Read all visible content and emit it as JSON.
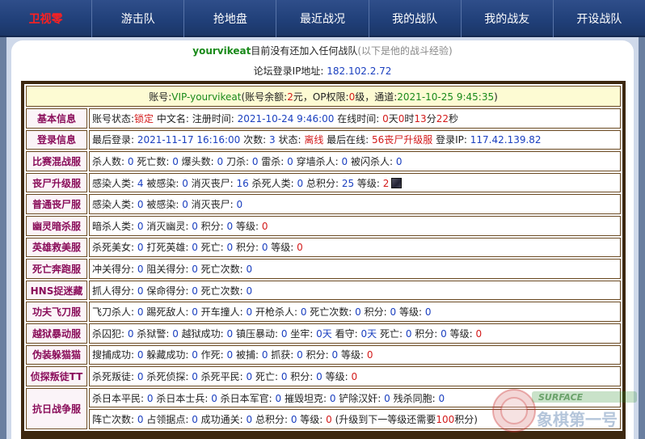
{
  "nav": {
    "items": [
      "卫视零",
      "游击队",
      "抢地盘",
      "最近战况",
      "我的战队",
      "我的战友",
      "开设战队"
    ]
  },
  "header": {
    "username": "yourvikeat",
    "status_text": "目前没有还加入任何战队",
    "hint": "(以下是他的战斗经验)"
  },
  "ip": {
    "label": "论坛登录IP地址:",
    "value": "182.102.2.72"
  },
  "account": {
    "p1": "账号:",
    "name": "VIP-yourvikeat",
    "p2": "(账号余额:",
    "balance": "2",
    "p3": "元，OP权限:",
    "op": "0",
    "p4": "级，通道:",
    "channel_time": "2021-10-25 9:45:35",
    "p5": ")"
  },
  "rows": [
    {
      "label": "基本信息",
      "segs": [
        {
          "t": "账号状态:",
          "c": "k"
        },
        {
          "t": "锁定",
          "c": "r"
        },
        {
          "t": " 中文名:  注册时间: ",
          "c": "k"
        },
        {
          "t": "2021-10-24 9:46:00",
          "c": "b"
        },
        {
          "t": " 在线时间: ",
          "c": "k"
        },
        {
          "t": "0",
          "c": "r"
        },
        {
          "t": "天",
          "c": "k"
        },
        {
          "t": "0",
          "c": "r"
        },
        {
          "t": "时",
          "c": "k"
        },
        {
          "t": "13",
          "c": "r"
        },
        {
          "t": "分",
          "c": "k"
        },
        {
          "t": "22",
          "c": "r"
        },
        {
          "t": "秒",
          "c": "k"
        }
      ]
    },
    {
      "label": "登录信息",
      "segs": [
        {
          "t": "最后登录: ",
          "c": "k"
        },
        {
          "t": "2021-11-17 16:16:00",
          "c": "b"
        },
        {
          "t": " 次数: ",
          "c": "k"
        },
        {
          "t": "3",
          "c": "b"
        },
        {
          "t": " 状态: ",
          "c": "k"
        },
        {
          "t": "离线",
          "c": "r"
        },
        {
          "t": " 最后在线: ",
          "c": "k"
        },
        {
          "t": "56丧尸升级服",
          "c": "r"
        },
        {
          "t": " 登录IP: ",
          "c": "k"
        },
        {
          "t": "117.42.139.82",
          "c": "b"
        }
      ]
    },
    {
      "label": "比赛混战服",
      "segs": [
        {
          "t": "杀人数: ",
          "c": "k"
        },
        {
          "t": "0",
          "c": "b"
        },
        {
          "t": " 死亡数: ",
          "c": "k"
        },
        {
          "t": "0",
          "c": "b"
        },
        {
          "t": " 爆头数: ",
          "c": "k"
        },
        {
          "t": "0",
          "c": "b"
        },
        {
          "t": " 刀杀: ",
          "c": "k"
        },
        {
          "t": "0",
          "c": "b"
        },
        {
          "t": " 雷杀: ",
          "c": "k"
        },
        {
          "t": "0",
          "c": "b"
        },
        {
          "t": " 穿墙杀人: ",
          "c": "k"
        },
        {
          "t": "0",
          "c": "b"
        },
        {
          "t": " 被闪杀人: ",
          "c": "k"
        },
        {
          "t": "0",
          "c": "b"
        }
      ]
    },
    {
      "label": "丧尸升级服",
      "avatar": true,
      "segs": [
        {
          "t": "感染人类: ",
          "c": "k"
        },
        {
          "t": "4",
          "c": "b"
        },
        {
          "t": " 被感染: ",
          "c": "k"
        },
        {
          "t": "0",
          "c": "b"
        },
        {
          "t": " 消灭丧尸: ",
          "c": "k"
        },
        {
          "t": "16",
          "c": "b"
        },
        {
          "t": " 杀死人类: ",
          "c": "k"
        },
        {
          "t": "0",
          "c": "b"
        },
        {
          "t": " 总积分: ",
          "c": "k"
        },
        {
          "t": "25",
          "c": "b"
        },
        {
          "t": " 等级: ",
          "c": "k"
        },
        {
          "t": "2",
          "c": "r"
        }
      ]
    },
    {
      "label": "普通丧尸服",
      "segs": [
        {
          "t": "感染人类: ",
          "c": "k"
        },
        {
          "t": "0",
          "c": "b"
        },
        {
          "t": " 被感染: ",
          "c": "k"
        },
        {
          "t": "0",
          "c": "b"
        },
        {
          "t": " 消灭丧尸: ",
          "c": "k"
        },
        {
          "t": "0",
          "c": "b"
        }
      ]
    },
    {
      "label": "幽灵暗杀服",
      "segs": [
        {
          "t": "暗杀人类: ",
          "c": "k"
        },
        {
          "t": "0",
          "c": "b"
        },
        {
          "t": " 消灭幽灵: ",
          "c": "k"
        },
        {
          "t": "0",
          "c": "b"
        },
        {
          "t": " 积分: ",
          "c": "k"
        },
        {
          "t": "0",
          "c": "b"
        },
        {
          "t": " 等级: ",
          "c": "k"
        },
        {
          "t": "0",
          "c": "r"
        }
      ]
    },
    {
      "label": "英雄救美服",
      "segs": [
        {
          "t": "杀死美女: ",
          "c": "k"
        },
        {
          "t": "0",
          "c": "b"
        },
        {
          "t": " 打死英雄: ",
          "c": "k"
        },
        {
          "t": "0",
          "c": "b"
        },
        {
          "t": " 死亡: ",
          "c": "k"
        },
        {
          "t": "0",
          "c": "b"
        },
        {
          "t": " 积分: ",
          "c": "k"
        },
        {
          "t": "0",
          "c": "b"
        },
        {
          "t": " 等级: ",
          "c": "k"
        },
        {
          "t": "0",
          "c": "r"
        }
      ]
    },
    {
      "label": "死亡奔跑服",
      "segs": [
        {
          "t": "冲关得分: ",
          "c": "k"
        },
        {
          "t": "0",
          "c": "b"
        },
        {
          "t": " 阻关得分: ",
          "c": "k"
        },
        {
          "t": "0",
          "c": "b"
        },
        {
          "t": " 死亡次数: ",
          "c": "k"
        },
        {
          "t": "0",
          "c": "b"
        }
      ]
    },
    {
      "label": "HNS捉迷藏",
      "segs": [
        {
          "t": "抓人得分: ",
          "c": "k"
        },
        {
          "t": "0",
          "c": "b"
        },
        {
          "t": " 保命得分: ",
          "c": "k"
        },
        {
          "t": "0",
          "c": "b"
        },
        {
          "t": " 死亡次数: ",
          "c": "k"
        },
        {
          "t": "0",
          "c": "b"
        }
      ]
    },
    {
      "label": "功夫飞刀服",
      "segs": [
        {
          "t": "飞刀杀人: ",
          "c": "k"
        },
        {
          "t": "0",
          "c": "b"
        },
        {
          "t": " 踢死敌人: ",
          "c": "k"
        },
        {
          "t": "0",
          "c": "b"
        },
        {
          "t": " 开车撞人: ",
          "c": "k"
        },
        {
          "t": "0",
          "c": "b"
        },
        {
          "t": " 开枪杀人: ",
          "c": "k"
        },
        {
          "t": "0",
          "c": "b"
        },
        {
          "t": " 死亡次数: ",
          "c": "k"
        },
        {
          "t": "0",
          "c": "b"
        },
        {
          "t": " 积分: ",
          "c": "k"
        },
        {
          "t": "0",
          "c": "b"
        },
        {
          "t": " 等级: ",
          "c": "k"
        },
        {
          "t": "0",
          "c": "b"
        }
      ]
    },
    {
      "label": "越狱暴动服",
      "segs": [
        {
          "t": "杀囚犯: ",
          "c": "k"
        },
        {
          "t": "0",
          "c": "b"
        },
        {
          "t": " 杀狱警: ",
          "c": "k"
        },
        {
          "t": "0",
          "c": "b"
        },
        {
          "t": " 越狱成功: ",
          "c": "k"
        },
        {
          "t": "0",
          "c": "b"
        },
        {
          "t": " 镇压暴动: ",
          "c": "k"
        },
        {
          "t": "0",
          "c": "b"
        },
        {
          "t": " 坐牢: ",
          "c": "k"
        },
        {
          "t": "0天",
          "c": "b"
        },
        {
          "t": " 看守: ",
          "c": "k"
        },
        {
          "t": "0天",
          "c": "b"
        },
        {
          "t": " 死亡: ",
          "c": "k"
        },
        {
          "t": "0",
          "c": "b"
        },
        {
          "t": " 积分: ",
          "c": "k"
        },
        {
          "t": "0",
          "c": "b"
        },
        {
          "t": " 等级: ",
          "c": "k"
        },
        {
          "t": "0",
          "c": "r"
        }
      ]
    },
    {
      "label": "伪装躲猫猫",
      "segs": [
        {
          "t": "搜捕成功: ",
          "c": "k"
        },
        {
          "t": "0",
          "c": "b"
        },
        {
          "t": " 躲藏成功: ",
          "c": "k"
        },
        {
          "t": "0",
          "c": "b"
        },
        {
          "t": " 作死: ",
          "c": "k"
        },
        {
          "t": "0",
          "c": "b"
        },
        {
          "t": " 被捕: ",
          "c": "k"
        },
        {
          "t": "0",
          "c": "b"
        },
        {
          "t": " 抓获: ",
          "c": "k"
        },
        {
          "t": "0",
          "c": "b"
        },
        {
          "t": " 积分: ",
          "c": "k"
        },
        {
          "t": "0",
          "c": "b"
        },
        {
          "t": " 等级: ",
          "c": "k"
        },
        {
          "t": "0",
          "c": "r"
        }
      ]
    },
    {
      "label": "侦探叛徒TT",
      "segs": [
        {
          "t": "杀死叛徒: ",
          "c": "k"
        },
        {
          "t": "0",
          "c": "b"
        },
        {
          "t": " 杀死侦探: ",
          "c": "k"
        },
        {
          "t": "0",
          "c": "b"
        },
        {
          "t": " 杀死平民: ",
          "c": "k"
        },
        {
          "t": "0",
          "c": "b"
        },
        {
          "t": " 死亡: ",
          "c": "k"
        },
        {
          "t": "0",
          "c": "b"
        },
        {
          "t": " 积分: ",
          "c": "k"
        },
        {
          "t": "0",
          "c": "b"
        },
        {
          "t": " 等级: ",
          "c": "k"
        },
        {
          "t": "0",
          "c": "r"
        }
      ]
    }
  ],
  "anti": {
    "label": "抗日战争服",
    "line1": [
      {
        "t": "杀日本平民: ",
        "c": "k"
      },
      {
        "t": "0",
        "c": "b"
      },
      {
        "t": " 杀日本士兵: ",
        "c": "k"
      },
      {
        "t": "0",
        "c": "b"
      },
      {
        "t": " 杀日本军官: ",
        "c": "k"
      },
      {
        "t": "0",
        "c": "b"
      },
      {
        "t": " 摧毁坦克: ",
        "c": "k"
      },
      {
        "t": "0",
        "c": "b"
      },
      {
        "t": " 铲除汉奸: ",
        "c": "k"
      },
      {
        "t": "0",
        "c": "b"
      },
      {
        "t": " 残杀同胞: ",
        "c": "k"
      },
      {
        "t": "0",
        "c": "b"
      }
    ],
    "line2": [
      {
        "t": "阵亡次数: ",
        "c": "k"
      },
      {
        "t": "0",
        "c": "b"
      },
      {
        "t": " 占领据点: ",
        "c": "k"
      },
      {
        "t": "0",
        "c": "b"
      },
      {
        "t": " 成功通关: ",
        "c": "k"
      },
      {
        "t": "0",
        "c": "b"
      },
      {
        "t": " 总积分: ",
        "c": "k"
      },
      {
        "t": "0",
        "c": "b"
      },
      {
        "t": " 等级: ",
        "c": "k"
      },
      {
        "t": "0",
        "c": "r"
      },
      {
        "t": " (升级到下一等级还需要",
        "c": "k"
      },
      {
        "t": "100",
        "c": "r"
      },
      {
        "t": "积分)",
        "c": "k"
      }
    ]
  },
  "watermark": {
    "top": "SURFACE",
    "bottom": "象棋第一号"
  }
}
